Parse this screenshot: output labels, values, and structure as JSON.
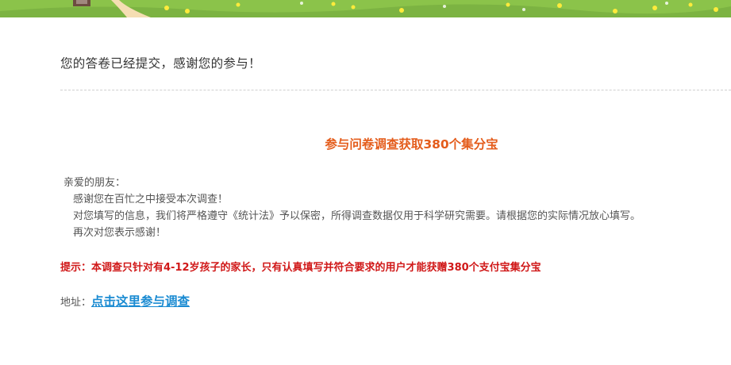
{
  "banner": {
    "icon": "cartoon-meadow-banner",
    "color": "#8bc34a"
  },
  "message": {
    "submitted": "您的答卷已经提交，感谢您的参与！"
  },
  "reward": {
    "title": "参与问卷调查获取380个集分宝",
    "color": "#e45c1b"
  },
  "letter": {
    "greeting": "亲爱的朋友：",
    "line1": "感谢您在百忙之中接受本次调查！",
    "line2": "对您填写的信息，我们将严格遵守《统计法》予以保密，所得调查数据仅用于科学研究需要。请根据您的实际情况放心填写。",
    "line3": "再次对您表示感谢！"
  },
  "tip": {
    "text": "提示：本调查只针对有4-12岁孩子的家长，只有认真填写并符合要求的用户才能获赠380个支付宝集分宝",
    "color": "#d01818"
  },
  "address": {
    "label": "地址：",
    "link_text": "点击这里参与调查",
    "link_color": "#1a8bd2"
  }
}
